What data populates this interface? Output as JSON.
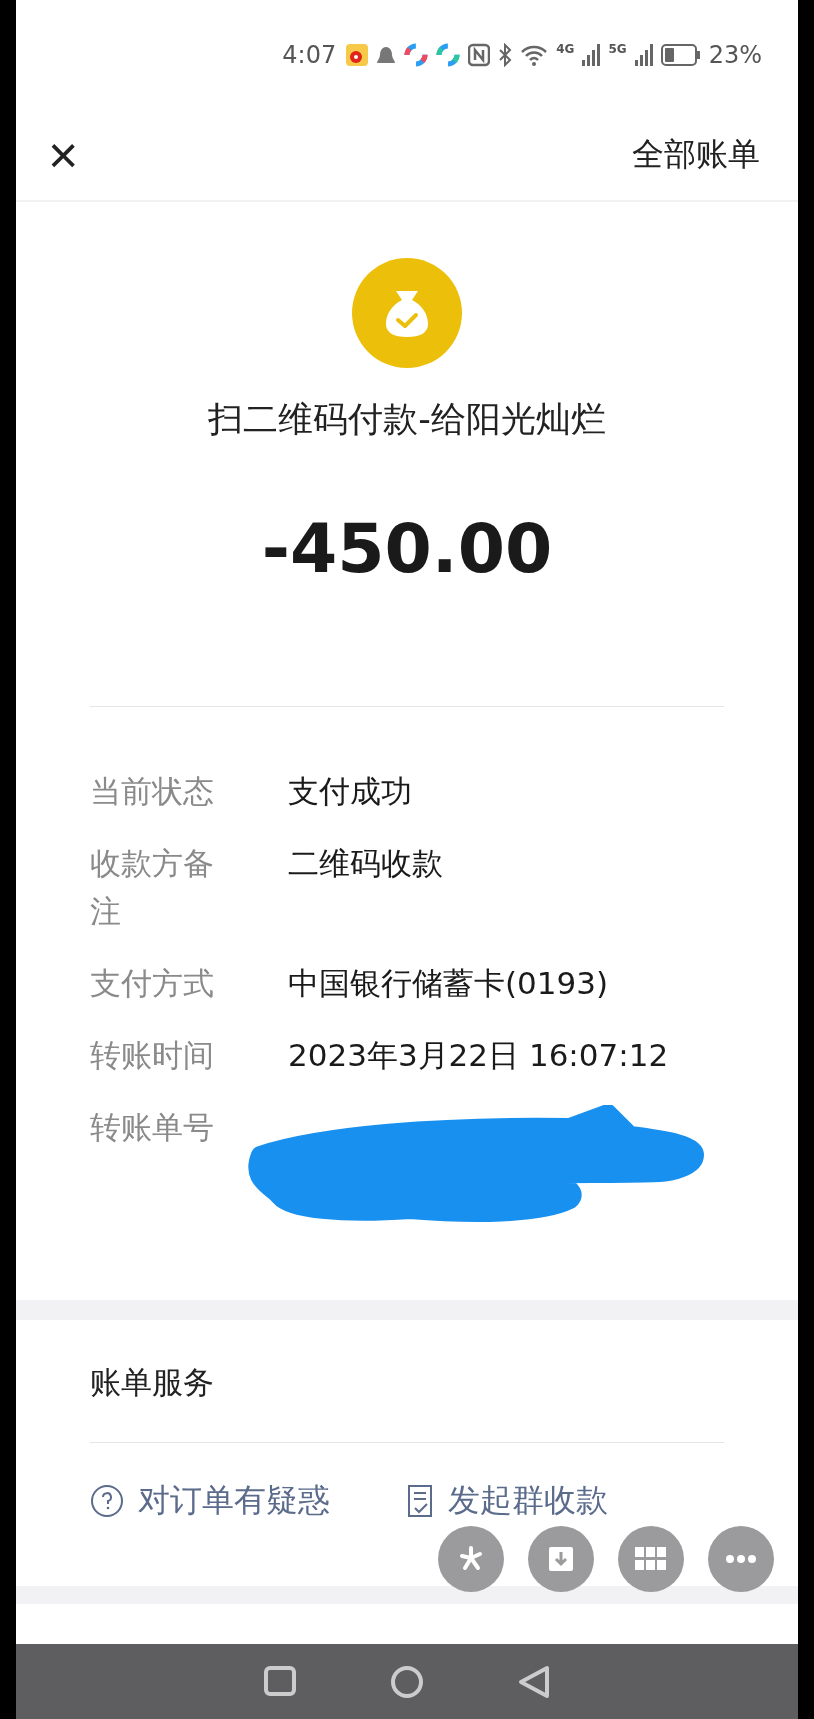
{
  "status_bar": {
    "time": "4:07",
    "network_1": "4G",
    "network_2": "5G",
    "battery": "23%"
  },
  "header": {
    "close": "×",
    "action": "全部账单"
  },
  "payment": {
    "title": "扫二维码付款-给阳光灿烂",
    "amount": "-450.00"
  },
  "details": [
    {
      "kind": "text",
      "label": "当前状态",
      "value": "支付成功"
    },
    {
      "kind": "text",
      "label": "收款方备注",
      "value": "二维码收款"
    },
    {
      "kind": "text",
      "label": "支付方式",
      "value": "中国银行储蓄卡(0193)"
    },
    {
      "kind": "text",
      "label": "转账时间",
      "value": "2023年3月22日 16:07:12"
    },
    {
      "kind": "redacted",
      "label": "转账单号"
    }
  ],
  "services": {
    "title": "账单服务",
    "links": [
      {
        "kind": "help",
        "label": "对订单有疑惑"
      },
      {
        "kind": "group",
        "label": "发起群收款"
      }
    ]
  },
  "floating_buttons": [
    {
      "kind": "star"
    },
    {
      "kind": "download"
    },
    {
      "kind": "grid"
    },
    {
      "kind": "more"
    }
  ]
}
